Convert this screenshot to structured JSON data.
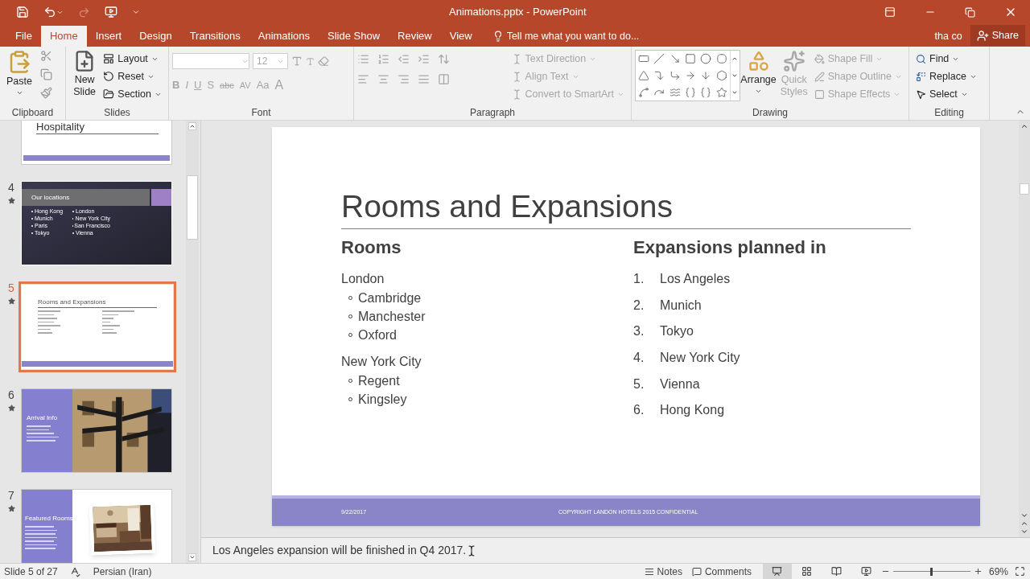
{
  "window": {
    "title": "Animations.pptx - PowerPoint"
  },
  "tabs": [
    {
      "label": "File",
      "selected": false
    },
    {
      "label": "Home",
      "selected": true
    },
    {
      "label": "Insert",
      "selected": false
    },
    {
      "label": "Design",
      "selected": false
    },
    {
      "label": "Transitions",
      "selected": false
    },
    {
      "label": "Animations",
      "selected": false
    },
    {
      "label": "Slide Show",
      "selected": false
    },
    {
      "label": "Review",
      "selected": false
    },
    {
      "label": "View",
      "selected": false
    }
  ],
  "tell_me": {
    "placeholder": "Tell me what you want to do..."
  },
  "account": {
    "user": "tha co",
    "share": "Share"
  },
  "ribbon": {
    "clipboard": {
      "label": "Clipboard",
      "paste": "Paste"
    },
    "slides": {
      "label": "Slides",
      "new_slide": "New Slide",
      "items": [
        {
          "label": "Layout",
          "disabled": false
        },
        {
          "label": "Reset",
          "disabled": false
        },
        {
          "label": "Section",
          "disabled": false
        }
      ]
    },
    "font": {
      "label": "Font",
      "size": "12",
      "disabled": true,
      "format_buttons": [
        "B",
        "I",
        "U",
        "S",
        "abc",
        "AV",
        "Aa",
        "A"
      ]
    },
    "paragraph": {
      "label": "Paragraph",
      "items": [
        {
          "label": "Text Direction",
          "disabled": true
        },
        {
          "label": "Align Text",
          "disabled": true
        },
        {
          "label": "Convert to SmartArt",
          "disabled": true
        }
      ]
    },
    "drawing": {
      "label": "Drawing",
      "arrange": "Arrange",
      "quick_styles": {
        "label": "Quick Styles",
        "disabled": true
      },
      "items": [
        {
          "label": "Shape Fill",
          "disabled": true
        },
        {
          "label": "Shape Outline",
          "disabled": true
        },
        {
          "label": "Shape Effects",
          "disabled": true
        }
      ]
    },
    "editing": {
      "label": "Editing",
      "items": [
        {
          "label": "Find",
          "disabled": false
        },
        {
          "label": "Replace",
          "disabled": false
        },
        {
          "label": "Select",
          "disabled": false
        }
      ]
    }
  },
  "thumbnails": [
    {
      "kind": "title",
      "title": "Hospitality",
      "selected": false
    },
    {
      "kind": "dark",
      "number": "4",
      "animated": true,
      "selected": false,
      "title": "Our locations",
      "bullets": [
        "Hong Kong",
        "London",
        "Munich",
        "New York City",
        "Paris",
        "San Francisco",
        "Tokyo",
        "Vienna"
      ]
    },
    {
      "kind": "content",
      "number": "5",
      "animated": true,
      "selected": true,
      "title": "Rooms and Expansions"
    },
    {
      "number": "6",
      "animated": true,
      "selected": false,
      "title": "Arrival Info"
    },
    {
      "kind": "card",
      "number": "7",
      "animated": true,
      "selected": false,
      "title": "Featured Rooms"
    }
  ],
  "slide": {
    "title": "Rooms and Expansions",
    "left": {
      "heading": "Rooms",
      "groups": [
        {
          "name": "London",
          "items": [
            "Cambridge",
            "Manchester",
            "Oxford"
          ]
        },
        {
          "name": "New York City",
          "items": [
            "Regent",
            "Kingsley"
          ]
        }
      ]
    },
    "right": {
      "heading": "Expansions planned in",
      "items": [
        {
          "number": "1.",
          "text": "Los Angeles"
        },
        {
          "number": "2.",
          "text": "Munich"
        },
        {
          "number": "3.",
          "text": "Tokyo"
        },
        {
          "number": "4.",
          "text": "New York City"
        },
        {
          "number": "5.",
          "text": "Vienna"
        },
        {
          "number": "6.",
          "text": "Hong Kong"
        }
      ]
    },
    "footer": {
      "date": "9/22/2017",
      "copyright": "COPYRIGHT LANDON HOTELS 2015 CONFIDENTIAL"
    }
  },
  "notes": "Los Angeles expansion will be finished in Q4 2017.",
  "status_bar": {
    "slide": "Slide 5 of 27",
    "language": "Persian (Iran)",
    "notes": "Notes",
    "comments": "Comments",
    "zoom": {
      "level": 0.5,
      "reading": "69%"
    }
  }
}
